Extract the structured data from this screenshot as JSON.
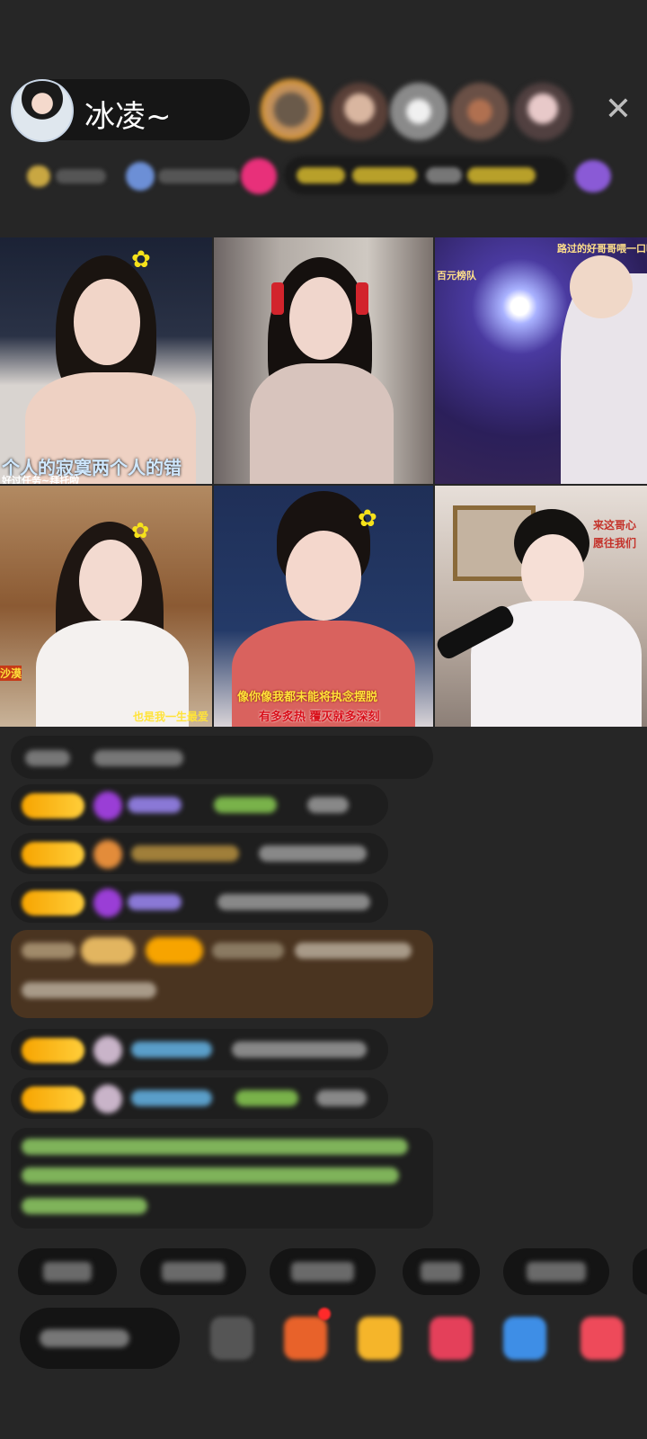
{
  "host": {
    "name": "冰凌~"
  },
  "header": {
    "close_icon": "close-icon"
  },
  "tiles": [
    {
      "caption_bottom": "个人的寂寞两个人的错",
      "caption_sub": "好过任务~拜托啦",
      "bg": "#cfc8c4"
    },
    {
      "bg": "#a39d99"
    },
    {
      "caption_top": "路过的好哥哥喂一口吧",
      "caption_side": "百元榜队",
      "bg": "#3a2c6e"
    },
    {
      "caption_bottom": "也是我一生最爱",
      "caption_left": "沙漠",
      "bg": "#8b5a33"
    },
    {
      "caption_line1": "像你像我都未能将执念摆脱",
      "caption_line2": "有多炙热  覆灭就多深刻",
      "bg": "#22345f"
    },
    {
      "caption_side": "来这哥心愿往我们",
      "bg": "#8c7f77"
    }
  ],
  "colors": {
    "accent_yellow": "#f7a400",
    "chat_bg": "#1e1e1e",
    "page_bg": "#262626"
  }
}
